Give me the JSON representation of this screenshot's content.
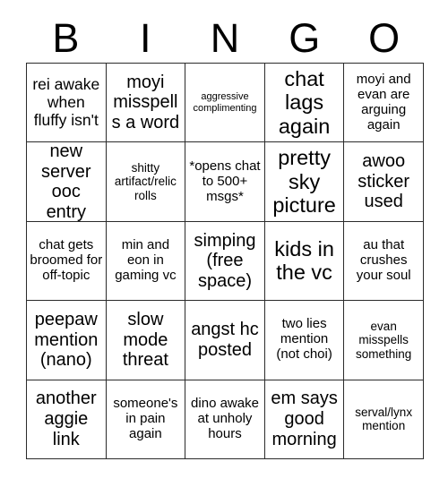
{
  "card": {
    "header_letters": [
      "B",
      "I",
      "N",
      "G",
      "O"
    ],
    "columns": 5,
    "rows": 5,
    "border_color": "#2b2b2b",
    "background_color": "#ffffff",
    "text_color": "#000000",
    "cells": [
      {
        "text": "rei awake when fluffy isn't",
        "size": "lg"
      },
      {
        "text": "moyi misspells a word",
        "size": "xl"
      },
      {
        "text": "aggressive complimenting",
        "size": "xs"
      },
      {
        "text": "chat lags again",
        "size": "xxl"
      },
      {
        "text": "moyi and evan are arguing again",
        "size": "md"
      },
      {
        "text": "new server ooc entry",
        "size": "xl"
      },
      {
        "text": "shitty artifact/relic rolls",
        "size": "sm"
      },
      {
        "text": "*opens chat to 500+ msgs*",
        "size": "md"
      },
      {
        "text": "pretty sky picture",
        "size": "xxl"
      },
      {
        "text": "awoo sticker used",
        "size": "xl"
      },
      {
        "text": "chat gets broomed for off-topic",
        "size": "md"
      },
      {
        "text": "min and eon in gaming vc",
        "size": "md"
      },
      {
        "text": "simping (free space)",
        "size": "xl"
      },
      {
        "text": "kids in the vc",
        "size": "xxl"
      },
      {
        "text": "au that crushes your soul",
        "size": "md"
      },
      {
        "text": "peepaw mention (nano)",
        "size": "xl"
      },
      {
        "text": "slow mode threat",
        "size": "xl"
      },
      {
        "text": "angst hc posted",
        "size": "xl"
      },
      {
        "text": "two lies mention (not choi)",
        "size": "md"
      },
      {
        "text": "evan misspells something",
        "size": "sm"
      },
      {
        "text": "another aggie link",
        "size": "xl"
      },
      {
        "text": "someone's in pain again",
        "size": "md"
      },
      {
        "text": "dino awake at unholy hours",
        "size": "md"
      },
      {
        "text": "em says good morning",
        "size": "xl"
      },
      {
        "text": "serval/lynx mention",
        "size": "sm"
      }
    ]
  }
}
